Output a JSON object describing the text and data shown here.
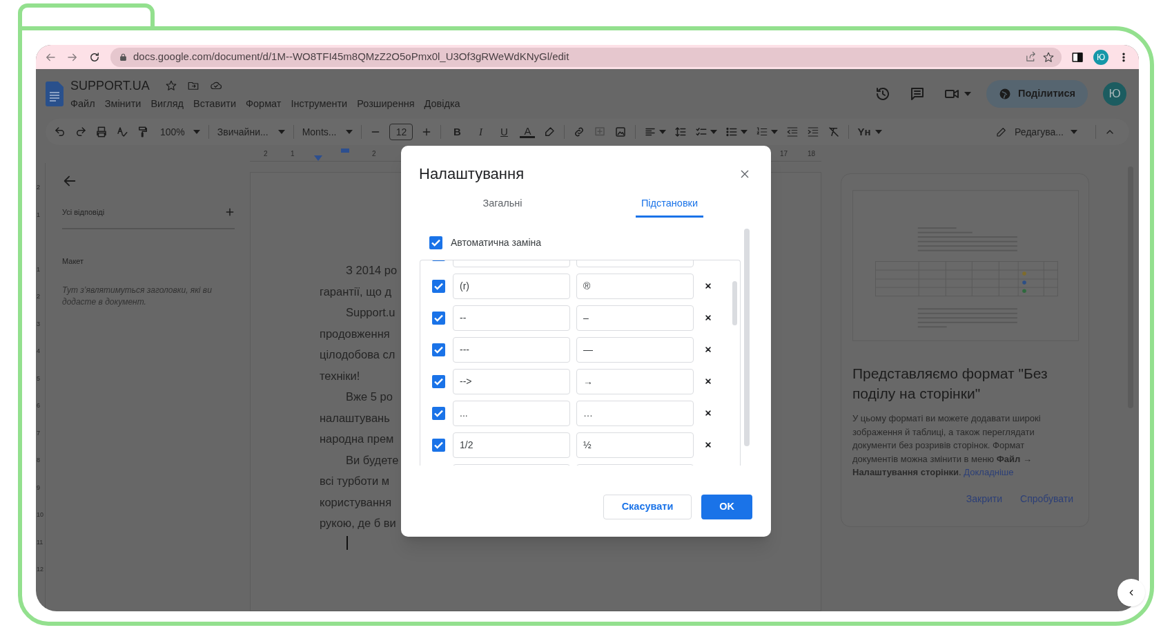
{
  "browser": {
    "url": "docs.google.com/document/d/1M--WO8TFI45m8QMzZ2O5oPmx0l_U3Of3gRWeWdKNyGl/edit",
    "profile_initial": "Ю"
  },
  "document": {
    "title": "SUPPORT.UA",
    "menu": [
      "Файл",
      "Змінити",
      "Вигляд",
      "Вставити",
      "Формат",
      "Інструменти",
      "Розширення",
      "Довідка"
    ],
    "share_label": "Поділитися",
    "avatar_initial": "Ю"
  },
  "toolbar": {
    "zoom": "100%",
    "style": "Звичайни...",
    "font": "Monts...",
    "font_size": "12",
    "format_glyphs": [
      "B",
      "I",
      "U",
      "A"
    ],
    "input_tools": "Yн",
    "mode": "Редагува..."
  },
  "ruler": {
    "horizontal_labels": [
      "2",
      "1",
      "2",
      "17",
      "18"
    ],
    "vertical_labels": [
      "2",
      "1",
      "1",
      "2",
      "3",
      "4",
      "5",
      "6",
      "7",
      "8",
      "9",
      "10",
      "11",
      "12"
    ]
  },
  "outline": {
    "replies_label": "Усі відповіді",
    "section": "Макет",
    "hint": "Тут з’являтимуться заголовки, які ви додасте в документ."
  },
  "page_paragraphs": [
    {
      "lines": [
        "З 2014 ро",
        "гарантії, що д"
      ]
    },
    {
      "lines": [
        "Support.u",
        "продовження",
        "цілодобова сл",
        "техніки!"
      ]
    },
    {
      "lines": [
        "Вже 5 ро",
        "налаштувань",
        "народна прем"
      ]
    },
    {
      "lines": [
        "Ви будете",
        "всі турботи м",
        "користування",
        "рукою, де б ви"
      ]
    }
  ],
  "dialog": {
    "title": "Налаштування",
    "tabs": [
      {
        "label": "Загальні",
        "selected": false
      },
      {
        "label": "Підстановки",
        "selected": true
      }
    ],
    "auto_replace": {
      "label": "Автоматична заміна",
      "checked": true
    },
    "substitutions": [
      {
        "checked": true,
        "replace": "(r)",
        "with": "®"
      },
      {
        "checked": true,
        "replace": "--",
        "with": "–"
      },
      {
        "checked": true,
        "replace": "---",
        "with": "—"
      },
      {
        "checked": true,
        "replace": "-->",
        "with": "→"
      },
      {
        "checked": true,
        "replace": "...",
        "with": "…"
      },
      {
        "checked": true,
        "replace": "1/2",
        "with": "½"
      }
    ],
    "buttons": [
      {
        "label": "Скасувати",
        "kind": "secondary"
      },
      {
        "label": "OK",
        "kind": "primary"
      }
    ]
  },
  "promo": {
    "title": "Представляємо формат \"Без поділу на сторінки\"",
    "body": "У цьому форматі ви можете додавати широкі зображення й таблиці, а також переглядати документи без розривів сторінок. Формат документів можна змінити в меню **Файл** → **Налаштування сторінки**.",
    "link": "Докладніше",
    "actions": [
      "Закрити",
      "Спробувати"
    ]
  }
}
